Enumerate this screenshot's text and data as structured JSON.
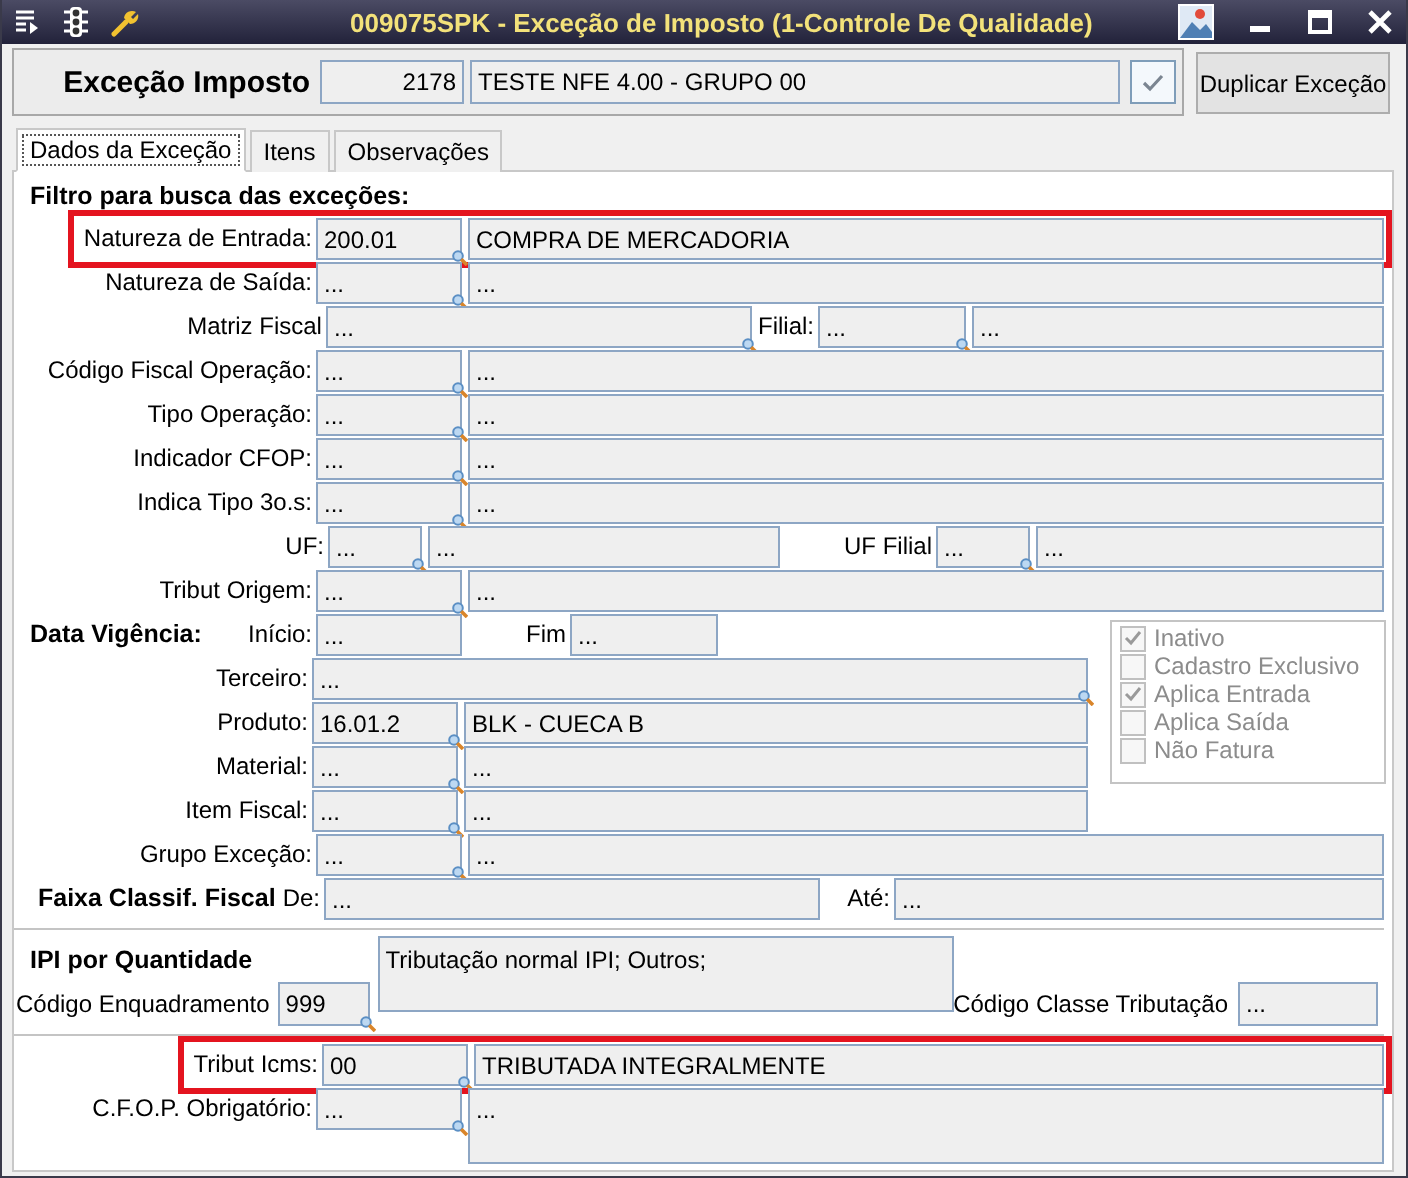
{
  "window": {
    "title": "009075SPK - Exceção de Imposto (1-Controle De Qualidade)"
  },
  "header": {
    "label": "Exceção Imposto",
    "code": "2178",
    "description": "TESTE NFE 4.00 - GRUPO 00",
    "button": "Duplicar Exceção"
  },
  "tabs": [
    {
      "label": "Dados da Exceção",
      "selected": true
    },
    {
      "label": "Itens",
      "selected": false
    },
    {
      "label": "Observações",
      "selected": false
    }
  ],
  "filter": {
    "title": "Filtro para busca das exceções:",
    "rows": [
      {
        "kind": "lookup",
        "label": "Natureza de Entrada:",
        "code": "200.01",
        "description": "COMPRA DE MERCADORIA",
        "highlighted": true
      },
      {
        "kind": "lookup",
        "label": "Natureza de Saída:",
        "code": "...",
        "description": "...",
        "highlighted": false
      },
      {
        "kind": "matriz",
        "label": "Matriz Fiscal",
        "value": "...",
        "second_label": "Filial:",
        "code": "...",
        "description": "...",
        "highlighted": false
      },
      {
        "kind": "lookup",
        "label": "Código Fiscal Operação:",
        "code": "...",
        "description": "...",
        "highlighted": false
      },
      {
        "kind": "lookup",
        "label": "Tipo Operação:",
        "code": "...",
        "description": "...",
        "highlighted": false
      },
      {
        "kind": "lookup",
        "label": "Indicador CFOP:",
        "code": "...",
        "description": "...",
        "highlighted": false
      },
      {
        "kind": "lookup",
        "label": "Indica Tipo 3o.s:",
        "code": "...",
        "description": "...",
        "highlighted": false
      },
      {
        "kind": "uf",
        "label": "UF:",
        "value": "...",
        "value_description": "...",
        "second_label": "UF Filial",
        "code": "...",
        "description": "...",
        "highlighted": false
      },
      {
        "kind": "lookup",
        "label": "Tribut Origem:",
        "code": "...",
        "description": "...",
        "highlighted": false
      }
    ]
  },
  "vigencia": {
    "title": "Data Vigência:",
    "start_label": "Início:",
    "start": "...",
    "end_label": "Fim",
    "end": "...",
    "rows": [
      {
        "kind": "single",
        "label": "Terceiro:",
        "value": "..."
      },
      {
        "kind": "lookup",
        "label": "Produto:",
        "code": "16.01.2",
        "description": "BLK - CUECA B"
      },
      {
        "kind": "lookup",
        "label": "Material:",
        "code": "...",
        "description": "..."
      },
      {
        "kind": "lookup",
        "label": "Item Fiscal:",
        "code": "...",
        "description": "..."
      }
    ]
  },
  "options": [
    {
      "label": "Inativo",
      "checked": true,
      "disabled": true
    },
    {
      "label": "Cadastro Exclusivo",
      "checked": false,
      "disabled": true
    },
    {
      "label": "Aplica Entrada",
      "checked": true,
      "disabled": true
    },
    {
      "label": "Aplica Saída",
      "checked": false,
      "disabled": true
    },
    {
      "label": "Não Fatura",
      "checked": false,
      "disabled": true
    }
  ],
  "grupo": {
    "label": "Grupo Exceção:",
    "code": "...",
    "description": "..."
  },
  "faixa": {
    "title": "Faixa Classif. Fiscal",
    "from_label": "De:",
    "from": "...",
    "to_label": "Até:",
    "to": "..."
  },
  "ipi": {
    "title": "IPI por Quantidade",
    "note": "Tributação normal IPI; Outros;",
    "code_label": "Código Enquadramento",
    "code": "999",
    "class_label": "Código Classe Tributação",
    "class_value": "..."
  },
  "icms": {
    "label": "Tribut Icms:",
    "code": "00",
    "description": "TRIBUTADA INTEGRALMENTE",
    "highlighted": true
  },
  "cfop": {
    "label": "C.F.O.P. Obrigatório:",
    "code": "...",
    "description": "..."
  }
}
